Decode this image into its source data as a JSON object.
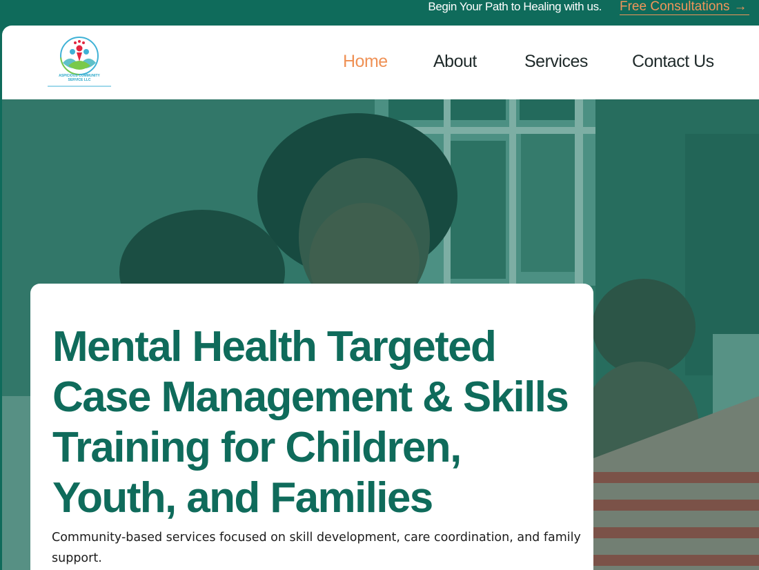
{
  "topbar": {
    "tagline": "Begin Your Path to Healing with us.",
    "cta_label": "Free Consultations",
    "cta_icon": "arrow-right-icon"
  },
  "logo": {
    "text_line1": "ASPICIOUS COMMUNITY",
    "text_line2": "SERVICE LLC"
  },
  "nav": {
    "items": [
      {
        "label": "Home",
        "active": true
      },
      {
        "label": "About",
        "active": false
      },
      {
        "label": "Services",
        "active": false
      },
      {
        "label": "Contact Us",
        "active": false
      }
    ]
  },
  "hero": {
    "heading": "Mental Health Targeted Case Management & Skills Training for Children, Youth, and Families",
    "subheading": "Community-based services focused on skill development, care coordination, and family support."
  },
  "colors": {
    "brand_green": "#0f6b5b",
    "accent_orange": "#ef9155"
  }
}
